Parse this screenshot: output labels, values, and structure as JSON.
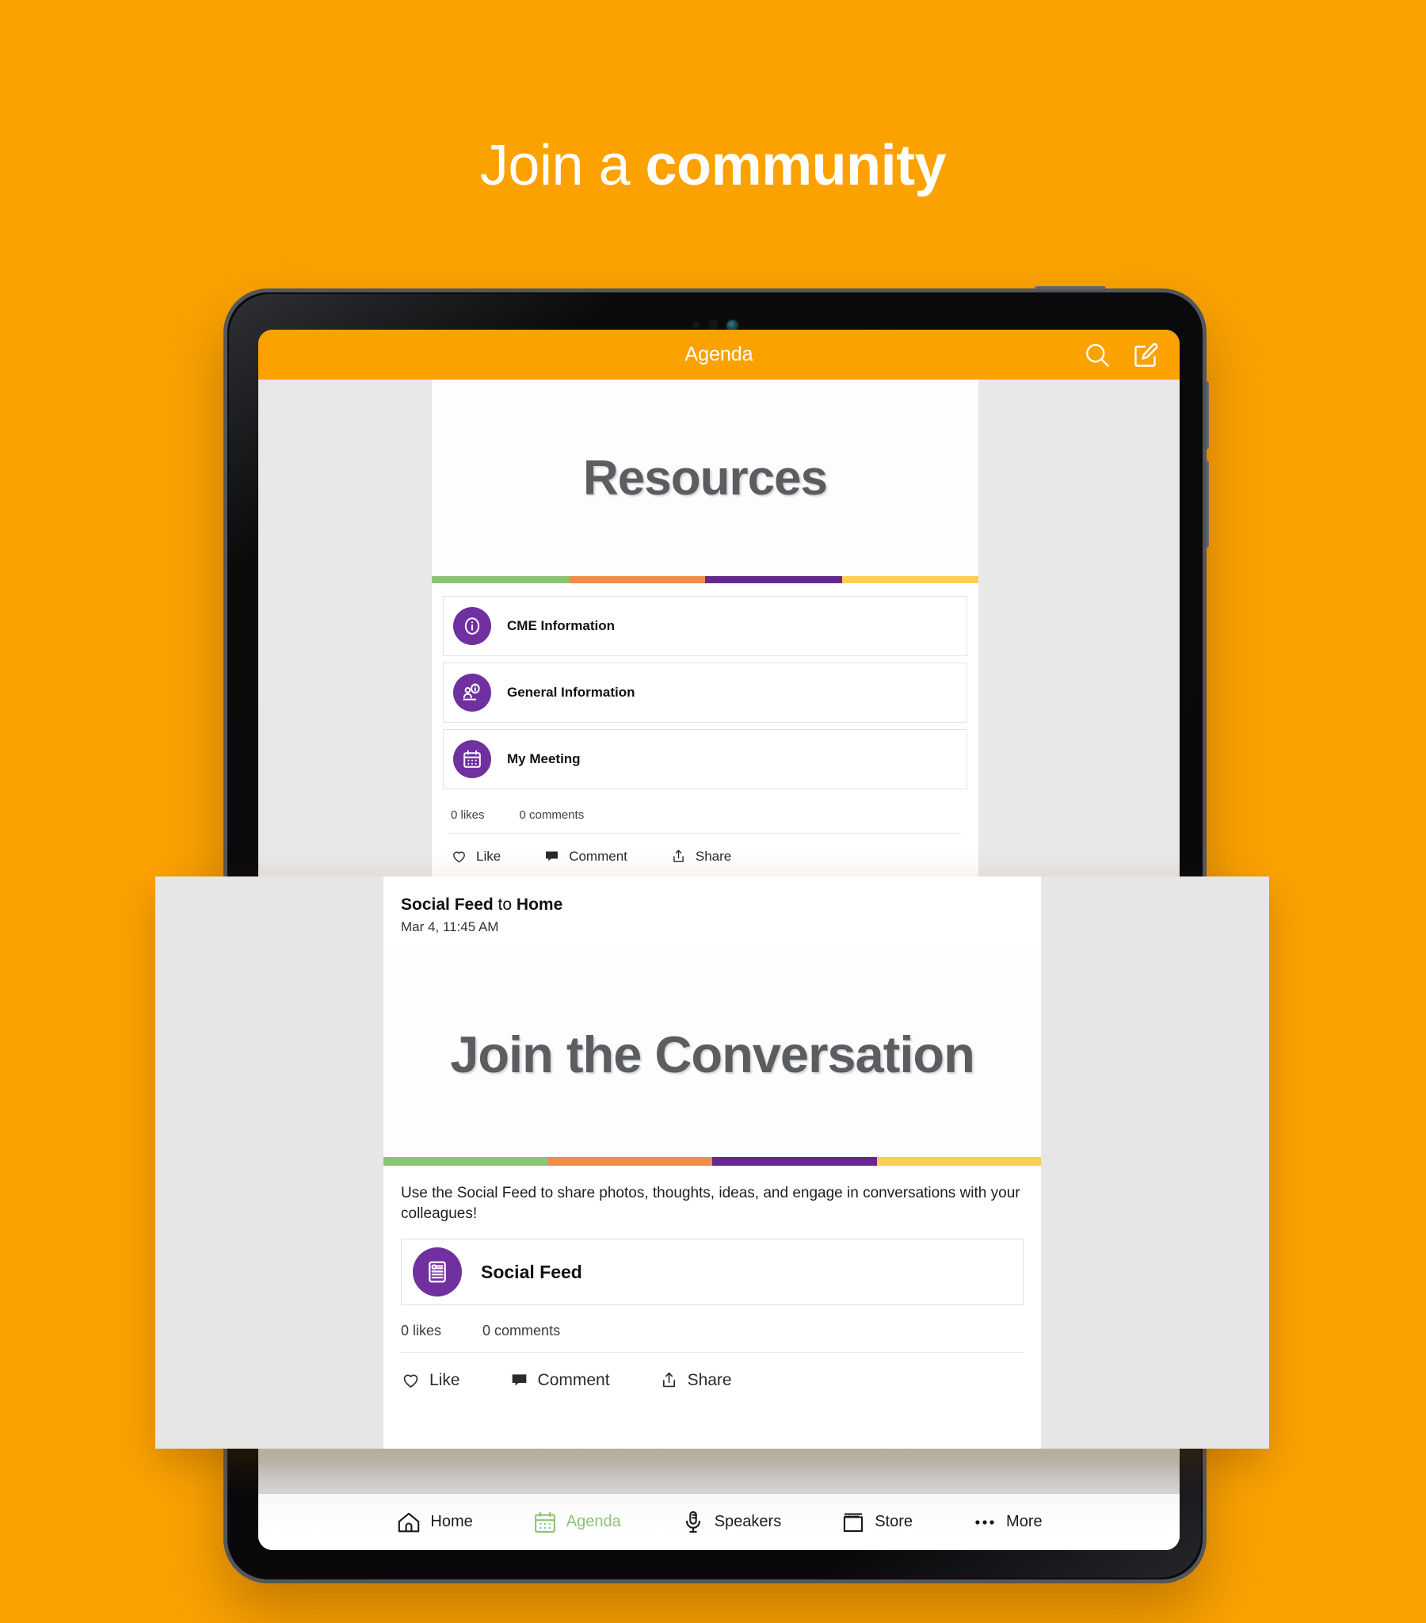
{
  "hero": {
    "text_regular": "Join a ",
    "text_bold": "community"
  },
  "colors": {
    "brand_orange": "#FBA200",
    "accent_purple": "#7030A0",
    "active_green": "#8CC474",
    "stripe_green": "#8CC474",
    "stripe_orange": "#F08C4B",
    "stripe_purple": "#63298E",
    "stripe_yellow": "#FBCF50"
  },
  "app_header": {
    "title": "Agenda",
    "search_icon": "search-icon",
    "compose_icon": "compose-icon"
  },
  "feed_post": {
    "banner_title": "Resources",
    "stripe": [
      "#8CC474",
      "#F08C4B",
      "#63298E",
      "#FBCF50"
    ],
    "items": [
      {
        "label": "CME Information",
        "icon": "info-circle-icon"
      },
      {
        "label": "General Information",
        "icon": "person-info-icon"
      },
      {
        "label": "My Meeting",
        "icon": "calendar-icon"
      }
    ],
    "likes": "0 likes",
    "comments": "0 comments",
    "actions": [
      {
        "label": "Like",
        "icon": "heart-icon"
      },
      {
        "label": "Comment",
        "icon": "comment-icon"
      },
      {
        "label": "Share",
        "icon": "share-icon"
      }
    ]
  },
  "overlay_post": {
    "author": "Social Feed",
    "connector": " to ",
    "destination": "Home",
    "timestamp": "Mar 4, 11:45 AM",
    "banner_title": "Join the Conversation",
    "stripe": [
      "#8CC474",
      "#F08C4B",
      "#63298E",
      "#FBCF50"
    ],
    "body_text": "Use the Social Feed to share photos, thoughts, ideas, and engage in conversations with your colleagues!",
    "items": [
      {
        "label": "Social Feed",
        "icon": "feed-icon"
      }
    ],
    "likes": "0 likes",
    "comments": "0 comments",
    "actions": [
      {
        "label": "Like",
        "icon": "heart-icon"
      },
      {
        "label": "Comment",
        "icon": "comment-icon"
      },
      {
        "label": "Share",
        "icon": "share-icon"
      }
    ]
  },
  "tab_bar": {
    "tabs": [
      {
        "label": "Home",
        "icon": "home-icon",
        "active": false
      },
      {
        "label": "Agenda",
        "icon": "calendar-icon",
        "active": true
      },
      {
        "label": "Speakers",
        "icon": "microphone-icon",
        "active": false
      },
      {
        "label": "Store",
        "icon": "store-icon",
        "active": false
      },
      {
        "label": "More",
        "icon": "ellipsis-icon",
        "active": false
      }
    ]
  }
}
